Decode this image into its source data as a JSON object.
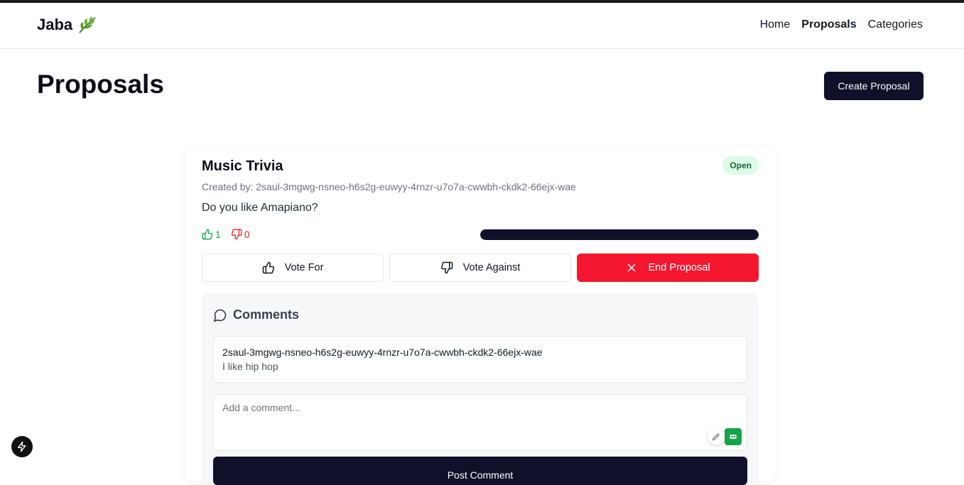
{
  "brand": {
    "name": "Jaba",
    "icon": "leaf-emoji"
  },
  "nav": {
    "home": "Home",
    "proposals": "Proposals",
    "categories": "Categories"
  },
  "page": {
    "title": "Proposals",
    "create_label": "Create Proposal"
  },
  "proposal": {
    "title": "Music Trivia",
    "status": "Open",
    "created_by": "Created by: 2saul-3mgwg-nsneo-h6s2g-euwyy-4rnzr-u7o7a-cwwbh-ckdk2-66ejx-wae",
    "question": "Do you like Amapiano?",
    "votes_for": "1",
    "votes_against": "0",
    "progress_fraction": 1.0,
    "vote_for_label": "Vote For",
    "vote_against_label": "Vote Against",
    "end_label": "End Proposal"
  },
  "comments": {
    "heading": "Comments",
    "items": [
      {
        "author": "2saul-3mgwg-nsneo-h6s2g-euwyy-4rnzr-u7o7a-cwwbh-ckdk2-66ejx-wae",
        "text": "I like hip hop"
      }
    ],
    "input_placeholder": "Add a comment...",
    "post_label": "Post Comment"
  },
  "colors": {
    "primary": "#10102a",
    "danger": "#f5172f",
    "success": "#16a34a",
    "badge_bg": "#dcfce7"
  }
}
